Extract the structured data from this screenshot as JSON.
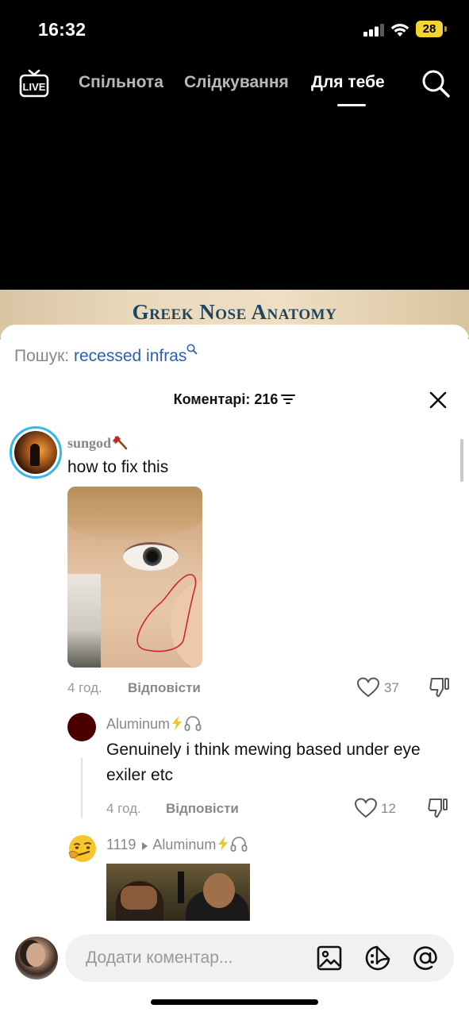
{
  "status_bar": {
    "time": "16:32",
    "battery": "28"
  },
  "nav": {
    "live_label": "LIVE",
    "tabs": [
      {
        "label": "Спільнота"
      },
      {
        "label": "Слідкування"
      },
      {
        "label": "Для тебе",
        "active": true
      }
    ]
  },
  "video": {
    "title": "Greek Nose Anatomy"
  },
  "search": {
    "label": "Пошук:",
    "term": "recessed infras"
  },
  "comments": {
    "header": "Коментарі: 216",
    "items": [
      {
        "user": "sungod",
        "text": "how to fix this",
        "time": "4 год.",
        "reply_label": "Відповісти",
        "likes": "37",
        "has_image": true,
        "replies": [
          {
            "user": "Aluminum",
            "text": "Genuinely i think mewing based under eye exiler etc",
            "time": "4 год.",
            "reply_label": "Відповісти",
            "likes": "12"
          },
          {
            "user": "1119",
            "reply_to": "Aluminum",
            "has_gif": true
          }
        ]
      }
    ]
  },
  "composer": {
    "placeholder": "Додати коментар..."
  },
  "colors": {
    "link_blue": "#2e5fa8",
    "story_ring": "#33b8e8",
    "lightning": "#f3c522",
    "annotation_red": "#d12020"
  }
}
